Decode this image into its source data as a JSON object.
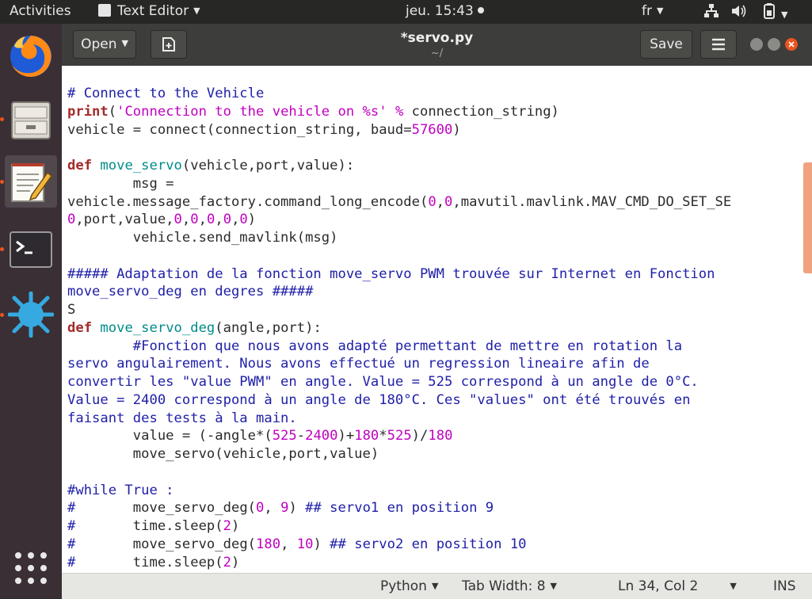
{
  "topbar": {
    "activities": "Activities",
    "app_name": "Text Editor",
    "clock": "jeu. 15:43",
    "language": "fr"
  },
  "header": {
    "open_label": "Open",
    "title": "*servo.py",
    "subtitle": "~/",
    "save_label": "Save"
  },
  "code_lines": [
    [
      [
        "cm",
        "# Connect to the Vehicle"
      ]
    ],
    [
      [
        "kw",
        "print"
      ],
      [
        "",
        "("
      ],
      [
        "st",
        "'Connection to the vehicle on %s'"
      ],
      [
        "",
        ""
      ],
      [
        "st",
        " % "
      ],
      [
        "",
        "connection_string)"
      ]
    ],
    [
      [
        "",
        "vehicle = connect(connection_string, baud="
      ],
      [
        "nm",
        "57600"
      ],
      [
        "",
        ")"
      ]
    ],
    [
      [
        "",
        ""
      ]
    ],
    [
      [
        "kw",
        "def"
      ],
      [
        "",
        " "
      ],
      [
        "fn",
        "move_servo"
      ],
      [
        "",
        "(vehicle,port,value):"
      ]
    ],
    [
      [
        "",
        "        msg ="
      ]
    ],
    [
      [
        "",
        "vehicle.message_factory.command_long_encode("
      ],
      [
        "nm",
        "0"
      ],
      [
        "",
        ","
      ],
      [
        "nm",
        "0"
      ],
      [
        "",
        ",mavutil.mavlink.MAV_CMD_DO_SET_SE"
      ]
    ],
    [
      [
        "nm",
        "0"
      ],
      [
        "",
        ",port,value,"
      ],
      [
        "nm",
        "0"
      ],
      [
        "",
        ","
      ],
      [
        "nm",
        "0"
      ],
      [
        "",
        ","
      ],
      [
        "nm",
        "0"
      ],
      [
        "",
        ","
      ],
      [
        "nm",
        "0"
      ],
      [
        "",
        ","
      ],
      [
        "nm",
        "0"
      ],
      [
        "",
        ")"
      ]
    ],
    [
      [
        "",
        "        vehicle.send_mavlink(msg)"
      ]
    ],
    [
      [
        "",
        ""
      ]
    ],
    [
      [
        "cm",
        "##### Adaptation de la fonction move_servo PWM trouvée sur Internet en Fonction"
      ]
    ],
    [
      [
        "cm",
        "move_servo_deg en degres #####"
      ]
    ],
    [
      [
        "",
        "S"
      ]
    ],
    [
      [
        "kw",
        "def"
      ],
      [
        "",
        " "
      ],
      [
        "fn",
        "move_servo_deg"
      ],
      [
        "",
        "(angle,port):"
      ]
    ],
    [
      [
        "cm",
        "        #Fonction que nous avons adapté permettant de mettre en rotation la"
      ]
    ],
    [
      [
        "cm",
        "servo angulairement. Nous avons effectué un regression lineaire afin de"
      ]
    ],
    [
      [
        "cm",
        "convertir les \"value PWM\" en angle. Value = 525 correspond à un angle de 0°C."
      ]
    ],
    [
      [
        "cm",
        "Value = 2400 correspond à un angle de 180°C. Ces \"values\" ont été trouvés en"
      ]
    ],
    [
      [
        "cm",
        "faisant des tests à la main."
      ]
    ],
    [
      [
        "",
        "        value = (-angle*("
      ],
      [
        "nm",
        "525"
      ],
      [
        "",
        "-"
      ],
      [
        "nm",
        "2400"
      ],
      [
        "",
        ")+"
      ],
      [
        "nm",
        "180"
      ],
      [
        "",
        "*"
      ],
      [
        "nm",
        "525"
      ],
      [
        "",
        ")/"
      ],
      [
        "nm",
        "180"
      ]
    ],
    [
      [
        "",
        "        move_servo(vehicle,port,value)"
      ]
    ],
    [
      [
        "",
        ""
      ]
    ],
    [
      [
        "cm",
        "#while True :"
      ]
    ],
    [
      [
        "cm",
        "#"
      ],
      [
        "",
        "       move_servo_deg("
      ],
      [
        "nm",
        "0"
      ],
      [
        "",
        ", "
      ],
      [
        "nm",
        "9"
      ],
      [
        "",
        ") "
      ],
      [
        "cm",
        "## servo1 en position 9"
      ]
    ],
    [
      [
        "cm",
        "#"
      ],
      [
        "",
        "       time.sleep("
      ],
      [
        "nm",
        "2"
      ],
      [
        "",
        ")"
      ]
    ],
    [
      [
        "cm",
        "#"
      ],
      [
        "",
        "       move_servo_deg("
      ],
      [
        "nm",
        "180"
      ],
      [
        "",
        ", "
      ],
      [
        "nm",
        "10"
      ],
      [
        "",
        ") "
      ],
      [
        "cm",
        "## servo2 en position 10"
      ]
    ],
    [
      [
        "cm",
        "#"
      ],
      [
        "",
        "       time.sleep("
      ],
      [
        "nm",
        "2"
      ],
      [
        "",
        ")"
      ]
    ]
  ],
  "statusbar": {
    "language": "Python",
    "tab_width": "Tab Width: 8",
    "position": "Ln 34, Col 2",
    "mode": "INS"
  },
  "colors": {
    "comment": "#2020a8",
    "keyword": "#a52a2a",
    "function": "#008b8b",
    "number": "#c000c0",
    "accent": "#e95420"
  }
}
